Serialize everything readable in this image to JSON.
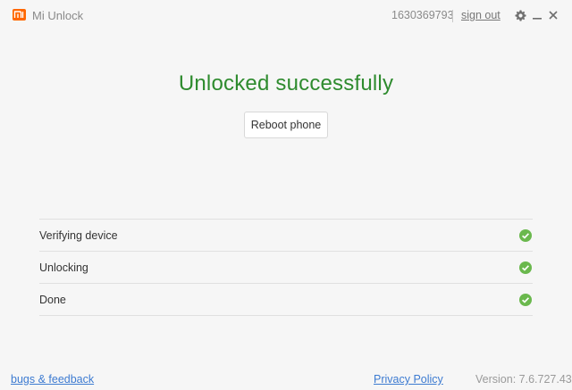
{
  "app": {
    "title": "Mi Unlock",
    "logo_icon": "mi-logo-icon",
    "brand_color": "#ff6700"
  },
  "account": {
    "id": "1630369793",
    "sign_out_label": "sign out"
  },
  "window_controls": {
    "settings_icon": "gear-icon",
    "minimize_icon": "minimize-icon",
    "close_icon": "close-icon"
  },
  "status": {
    "heading": "Unlocked successfully",
    "heading_color": "#2e8b2e",
    "reboot_label": "Reboot phone"
  },
  "steps": [
    {
      "label": "Verifying device",
      "state": "done",
      "icon": "check-circle-icon"
    },
    {
      "label": "Unlocking",
      "state": "done",
      "icon": "check-circle-icon"
    },
    {
      "label": "Done",
      "state": "done",
      "icon": "check-circle-icon"
    }
  ],
  "footer": {
    "bugs_label": "bugs & feedback",
    "privacy_label": "Privacy Policy",
    "version_label": "Version: 7.6.727.43"
  }
}
